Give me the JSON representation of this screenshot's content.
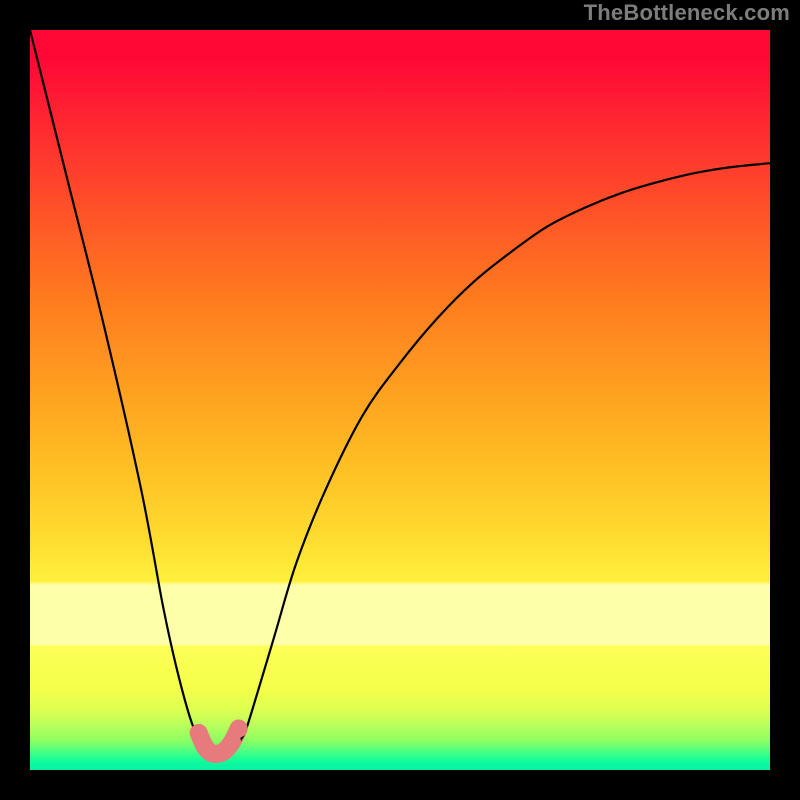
{
  "watermark": "TheBottleneck.com",
  "chart_data": {
    "type": "line",
    "title": "",
    "xlabel": "",
    "ylabel": "",
    "xlim": [
      0,
      100
    ],
    "ylim": [
      0,
      100
    ],
    "grid": false,
    "legend": false,
    "series": [
      {
        "name": "curve",
        "x": [
          0,
          5,
          10,
          15,
          18,
          20,
          22,
          24,
          25,
          26,
          27,
          28,
          29,
          30,
          33,
          36,
          40,
          45,
          50,
          55,
          60,
          65,
          70,
          75,
          80,
          85,
          90,
          95,
          100
        ],
        "values": [
          100,
          80,
          60,
          38,
          22,
          13,
          6,
          2.5,
          2,
          2,
          2.5,
          3.5,
          5,
          8,
          18,
          28,
          38,
          48,
          55,
          61,
          66,
          70,
          73.5,
          76,
          78,
          79.5,
          80.7,
          81.5,
          82
        ]
      }
    ],
    "markers": {
      "name": "highlight-dots",
      "color": "#e77a7d",
      "x": [
        22.8,
        23.6,
        24.5,
        25.4,
        26.3,
        27.3,
        28.2
      ],
      "values": [
        5.0,
        3.2,
        2.3,
        2.2,
        2.6,
        3.8,
        5.6
      ]
    }
  }
}
